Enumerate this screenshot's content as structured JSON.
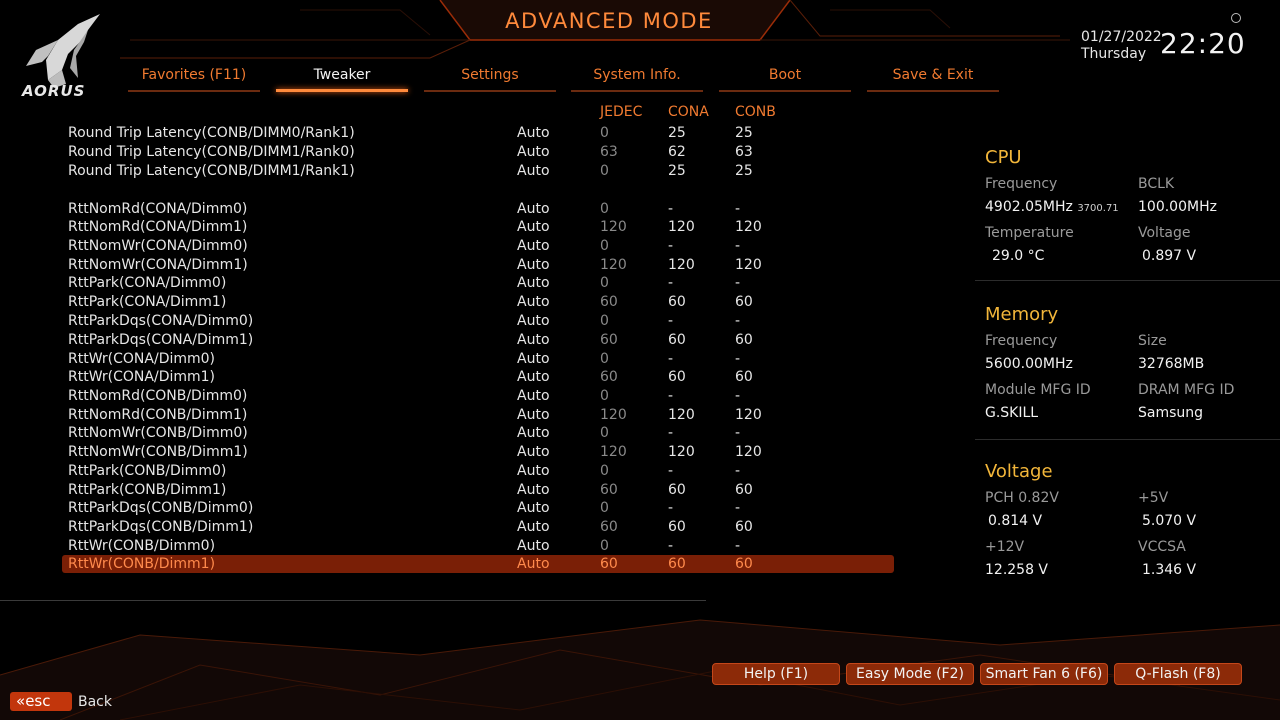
{
  "header": {
    "brand": "AORUS",
    "mode_title": "ADVANCED MODE",
    "date": "01/27/2022",
    "weekday": "Thursday",
    "time": "22:20",
    "accent_color": "#ff8a3c"
  },
  "tabs": [
    {
      "label": "Favorites (F11)"
    },
    {
      "label": "Tweaker"
    },
    {
      "label": "Settings"
    },
    {
      "label": "System Info."
    },
    {
      "label": "Boot"
    },
    {
      "label": "Save & Exit"
    }
  ],
  "active_tab": "Tweaker",
  "table": {
    "columns": {
      "jedec": "JEDEC",
      "cona": "CONA",
      "conb": "CONB"
    },
    "rows": [
      {
        "name": "Round Trip Latency(CONB/DIMM0/Rank1)",
        "value": "Auto",
        "jedec": "0",
        "cona": "25",
        "conb": "25"
      },
      {
        "name": "Round Trip Latency(CONB/DIMM1/Rank0)",
        "value": "Auto",
        "jedec": "63",
        "cona": "62",
        "conb": "63"
      },
      {
        "name": "Round Trip Latency(CONB/DIMM1/Rank1)",
        "value": "Auto",
        "jedec": "0",
        "cona": "25",
        "conb": "25"
      },
      {
        "name": "RttNomRd(CONA/Dimm0)",
        "value": "Auto",
        "jedec": "0",
        "cona": "-",
        "conb": "-"
      },
      {
        "name": "RttNomRd(CONA/Dimm1)",
        "value": "Auto",
        "jedec": "120",
        "cona": "120",
        "conb": "120"
      },
      {
        "name": "RttNomWr(CONA/Dimm0)",
        "value": "Auto",
        "jedec": "0",
        "cona": "-",
        "conb": "-"
      },
      {
        "name": "RttNomWr(CONA/Dimm1)",
        "value": "Auto",
        "jedec": "120",
        "cona": "120",
        "conb": "120"
      },
      {
        "name": "RttPark(CONA/Dimm0)",
        "value": "Auto",
        "jedec": "0",
        "cona": "-",
        "conb": "-"
      },
      {
        "name": "RttPark(CONA/Dimm1)",
        "value": "Auto",
        "jedec": "60",
        "cona": "60",
        "conb": "60"
      },
      {
        "name": "RttParkDqs(CONA/Dimm0)",
        "value": "Auto",
        "jedec": "0",
        "cona": "-",
        "conb": "-"
      },
      {
        "name": "RttParkDqs(CONA/Dimm1)",
        "value": "Auto",
        "jedec": "60",
        "cona": "60",
        "conb": "60"
      },
      {
        "name": "RttWr(CONA/Dimm0)",
        "value": "Auto",
        "jedec": "0",
        "cona": "-",
        "conb": "-"
      },
      {
        "name": "RttWr(CONA/Dimm1)",
        "value": "Auto",
        "jedec": "60",
        "cona": "60",
        "conb": "60"
      },
      {
        "name": "RttNomRd(CONB/Dimm0)",
        "value": "Auto",
        "jedec": "0",
        "cona": "-",
        "conb": "-"
      },
      {
        "name": "RttNomRd(CONB/Dimm1)",
        "value": "Auto",
        "jedec": "120",
        "cona": "120",
        "conb": "120"
      },
      {
        "name": "RttNomWr(CONB/Dimm0)",
        "value": "Auto",
        "jedec": "0",
        "cona": "-",
        "conb": "-"
      },
      {
        "name": "RttNomWr(CONB/Dimm1)",
        "value": "Auto",
        "jedec": "120",
        "cona": "120",
        "conb": "120"
      },
      {
        "name": "RttPark(CONB/Dimm0)",
        "value": "Auto",
        "jedec": "0",
        "cona": "-",
        "conb": "-"
      },
      {
        "name": "RttPark(CONB/Dimm1)",
        "value": "Auto",
        "jedec": "60",
        "cona": "60",
        "conb": "60"
      },
      {
        "name": "RttParkDqs(CONB/Dimm0)",
        "value": "Auto",
        "jedec": "0",
        "cona": "-",
        "conb": "-"
      },
      {
        "name": "RttParkDqs(CONB/Dimm1)",
        "value": "Auto",
        "jedec": "60",
        "cona": "60",
        "conb": "60"
      },
      {
        "name": "RttWr(CONB/Dimm0)",
        "value": "Auto",
        "jedec": "0",
        "cona": "-",
        "conb": "-"
      },
      {
        "name": "RttWr(CONB/Dimm1)",
        "value": "Auto",
        "jedec": "60",
        "cona": "60",
        "conb": "60"
      }
    ],
    "selected_row_name": "RttWr(CONB/Dimm1)",
    "selection_color": "#7a1f06"
  },
  "panel": {
    "cpu": {
      "title": "CPU",
      "freq_label": "Frequency",
      "freq": "4902.05MHz",
      "freq_sub": "3700.71",
      "bclk_label": "BCLK",
      "bclk": "100.00MHz",
      "temp_label": "Temperature",
      "temp": "29.0 °C",
      "volt_label": "Voltage",
      "volt": "0.897 V"
    },
    "memory": {
      "title": "Memory",
      "freq_label": "Frequency",
      "freq": "5600.00MHz",
      "size_label": "Size",
      "size": "32768MB",
      "module_label": "Module MFG ID",
      "module": "G.SKILL",
      "dram_label": "DRAM MFG ID",
      "dram": "Samsung"
    },
    "voltage": {
      "title": "Voltage",
      "pch_label": "PCH 0.82V",
      "pch": "0.814 V",
      "p5_label": "+5V",
      "p5": "5.070 V",
      "p12_label": "+12V",
      "p12": "12.258 V",
      "vccsa_label": "VCCSA",
      "vccsa": "1.346 V"
    },
    "title_color": "#f2b63a"
  },
  "footer": {
    "buttons": [
      {
        "label": "Help (F1)"
      },
      {
        "label": "Easy Mode (F2)"
      },
      {
        "label": "Smart Fan 6 (F6)"
      },
      {
        "label": "Q-Flash (F8)"
      }
    ],
    "esc_label": "esc",
    "back_label": "Back"
  }
}
